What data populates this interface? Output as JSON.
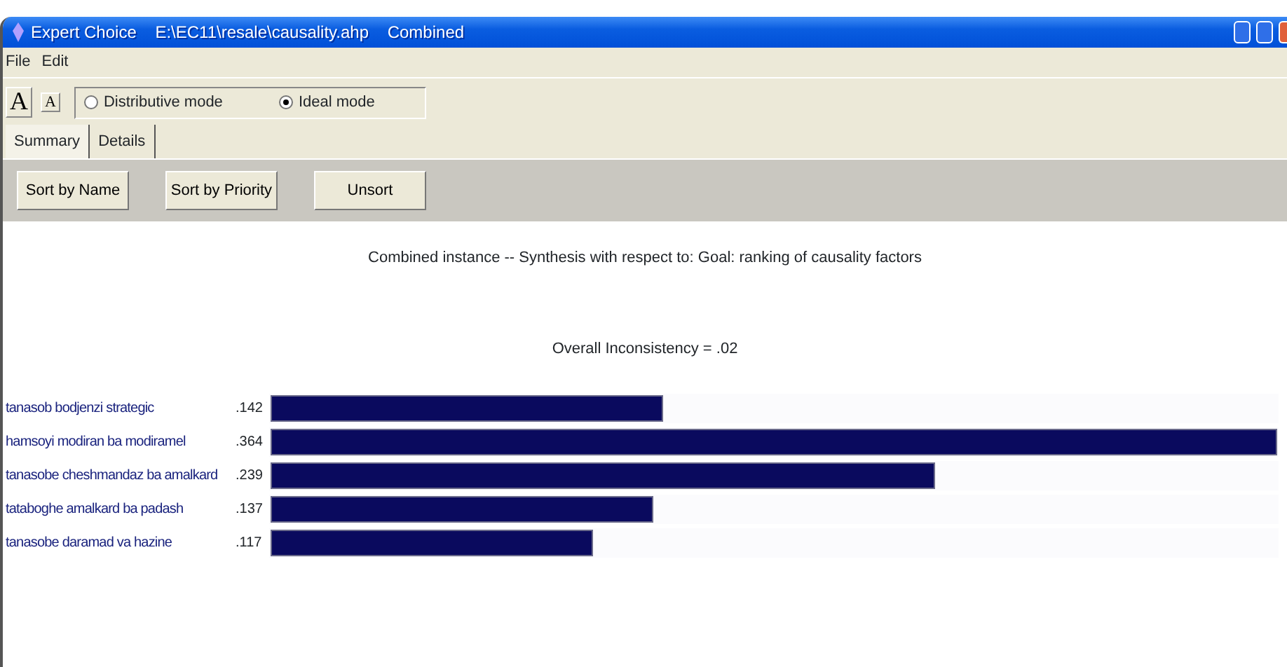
{
  "window": {
    "title": "Expert Choice    E:\\EC11\\resale\\causality.ahp    Combined"
  },
  "menu": [
    "File",
    "Edit"
  ],
  "font_buttons": [
    "A",
    "A"
  ],
  "modes": [
    {
      "label": "Distributive mode",
      "selected": false
    },
    {
      "label": "Ideal mode",
      "selected": true
    }
  ],
  "tabs": [
    {
      "label": "Summary",
      "selected": true
    },
    {
      "label": "Details",
      "selected": false
    }
  ],
  "sort_buttons": [
    "Sort by Name",
    "Sort by Priority",
    "Unsort"
  ],
  "synthesis": {
    "title": "Combined instance -- Synthesis with respect to: Goal: ranking of causality factors",
    "inconsistency": "Overall Inconsistency = .02",
    "rows": [
      {
        "name": "tanasob bodjenzi strategic",
        "value": ".142",
        "level": 0.39
      },
      {
        "name": "hamsoyi modiran ba modiramel",
        "value": ".364",
        "level": 1.0
      },
      {
        "name": "tanasobe cheshmandaz ba amalkard",
        "value": ".239",
        "level": 0.66
      },
      {
        "name": "tataboghe amalkard ba padash",
        "value": ".137",
        "level": 0.38
      },
      {
        "name": "tanasobe daramad va hazine",
        "value": ".117",
        "level": 0.32
      }
    ]
  }
}
